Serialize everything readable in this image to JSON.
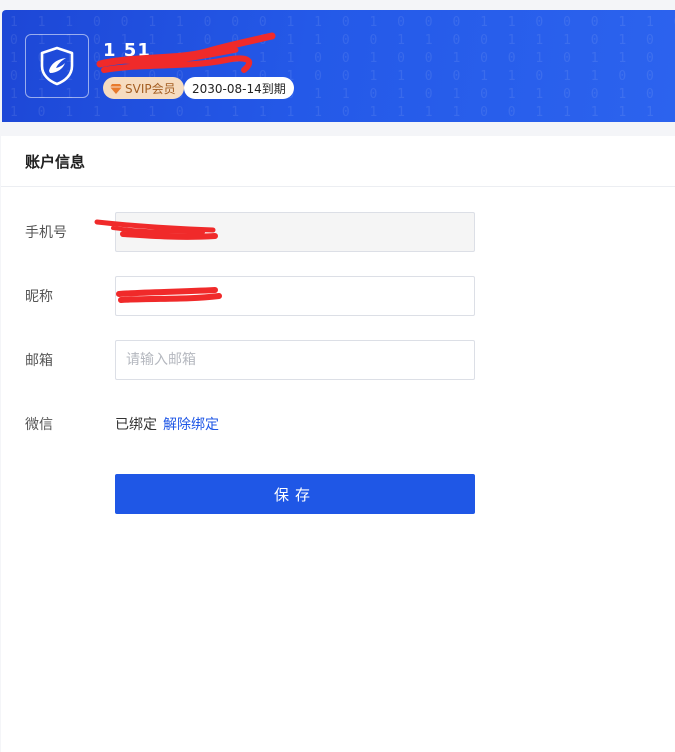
{
  "header": {
    "username": "1‍‍  51‍  ",
    "svip_label": "SVIP会员",
    "expire_label": "2030-08-14到期",
    "binary_rows": [
      "1 1 1 0 0 1 1 0 0 0 1 1 0 1 0 0 0 1 1 0 0 0 1 1 0 0 0",
      "0 1 1 0 1 1 1 0 0 0 1 1 0 0 1 1 0 0 1 1 1 0 1 0 1 0 1",
      "1 0 1 0 0 1 0 0 1 1 1 0 0 1 0 0 1 0 0 1 0 1 1 0 1 1 0",
      "0 1 1 0 1 0 0 1 1 0 1 0 0 1 1 0 0 1 1 0 1 1 0 0 1 1 1",
      "1 1 1 1 0 1 0 1 1 1 0 1 1 0 1 0 1 0 1 1 0 0 1 0 1 0 1",
      "1 0 1 1 1 1 0 1 1 1 1 1 0 1 1 1 1 0 0 1 1 1 1 1 1 0 1"
    ]
  },
  "panel": {
    "title": "账户信息",
    "phone_label": "手机号",
    "phone_value": "",
    "nickname_label": "昵称",
    "nickname_value": "",
    "email_label": "邮箱",
    "email_placeholder": "请输入邮箱",
    "wechat_label": "微信",
    "wechat_status": "已绑定",
    "wechat_unbind": "解除绑定",
    "save_label": "保存"
  },
  "colors": {
    "primary": "#1f57e6",
    "header_bg": "#2459e8",
    "svip_bg": "#f6dcc0",
    "svip_text": "#a45e22",
    "redaction": "#f02a2a"
  }
}
